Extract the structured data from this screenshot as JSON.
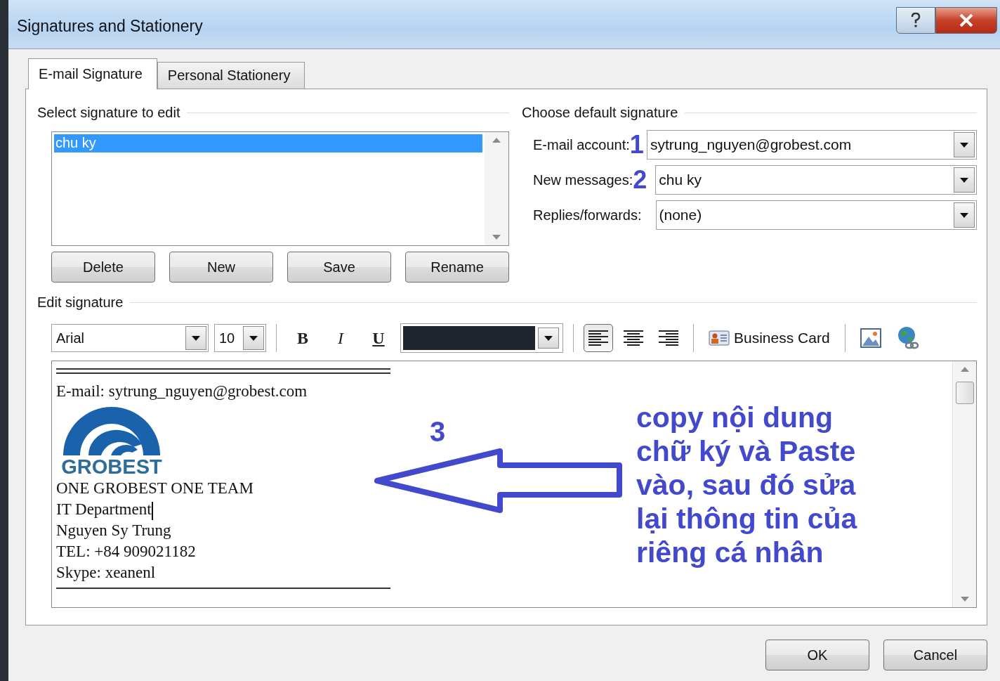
{
  "window": {
    "title": "Signatures and Stationery"
  },
  "tabs": [
    {
      "label": "E-mail Signature",
      "selected": true
    },
    {
      "label": "Personal Stationery",
      "selected": false
    }
  ],
  "select_signature": {
    "heading": "Select signature to edit",
    "items": [
      {
        "label": "chu ky",
        "selected": true
      }
    ],
    "buttons": [
      "Delete",
      "New",
      "Save",
      "Rename"
    ]
  },
  "default_signature": {
    "heading": "Choose default signature",
    "fields": [
      {
        "label": "E-mail account:",
        "marker": "1",
        "value": "sytrung_nguyen@grobest.com"
      },
      {
        "label": "New messages:",
        "marker": "2",
        "value": "chu ky"
      },
      {
        "label": "Replies/forwards:",
        "value": "(none)"
      }
    ]
  },
  "edit_signature": {
    "heading": "Edit signature",
    "font": "Arial",
    "size": "10",
    "format_buttons": [
      {
        "label": "B",
        "kind": "bold"
      },
      {
        "label": "I",
        "kind": "italic"
      },
      {
        "label": "U",
        "kind": "underline"
      }
    ],
    "alignment": [
      {
        "kind": "left",
        "selected": true
      },
      {
        "kind": "center",
        "selected": false
      },
      {
        "kind": "right",
        "selected": false
      }
    ],
    "business_card": "Business Card",
    "body": [
      {
        "kind": "double_rule"
      },
      {
        "kind": "text",
        "text": "E-mail: sytrung_nguyen@grobest.com"
      },
      {
        "kind": "logo",
        "text": "GROBEST"
      },
      {
        "kind": "text",
        "text": "ONE GROBEST ONE TEAM"
      },
      {
        "kind": "text",
        "text": "IT Department",
        "cursor": true
      },
      {
        "kind": "text",
        "text": "Nguyen Sy Trung"
      },
      {
        "kind": "text",
        "text": "TEL: +84 909021182"
      },
      {
        "kind": "text",
        "text": "Skype: xeanenl"
      },
      {
        "kind": "rule"
      }
    ]
  },
  "annotation": {
    "step": "3",
    "note": "copy nội dung chữ ký và Paste vào, sau đó sửa lại thông tin của riêng cá nhân"
  },
  "buttons": [
    "OK",
    "Cancel"
  ]
}
